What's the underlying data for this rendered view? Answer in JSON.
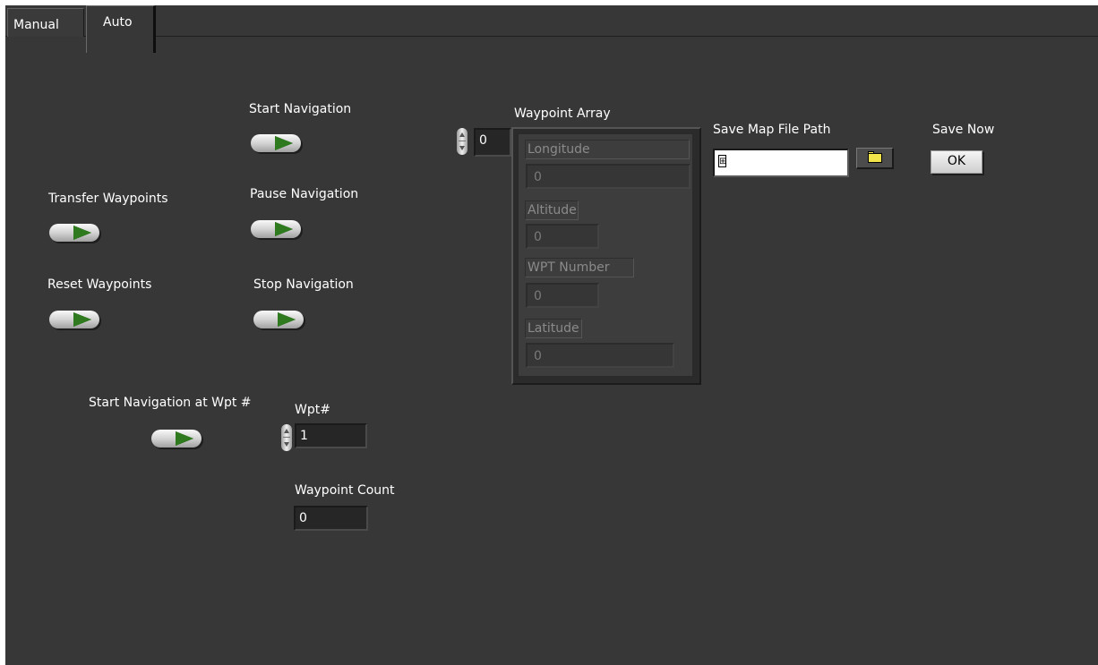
{
  "tabs": {
    "manual": "Manual",
    "auto": "Auto"
  },
  "controls": {
    "start_navigation": "Start Navigation",
    "pause_navigation": "Pause Navigation",
    "stop_navigation": "Stop Navigation",
    "transfer_waypoints": "Transfer Waypoints",
    "reset_waypoints": "Reset Waypoints",
    "start_navigation_at_wpt": "Start Navigation at Wpt #"
  },
  "wpt": {
    "label": "Wpt#",
    "value": "1"
  },
  "waypoint_count": {
    "label": "Waypoint Count",
    "value": "0"
  },
  "waypoint_array": {
    "label": "Waypoint Array",
    "index": "0",
    "fields": {
      "longitude": {
        "label": "Longitude",
        "value": "0"
      },
      "altitude": {
        "label": "Altitude",
        "value": "0"
      },
      "wpt_number": {
        "label": "WPT Number",
        "value": "0"
      },
      "latitude": {
        "label": "Latitude",
        "value": "0"
      }
    }
  },
  "save_map": {
    "label": "Save Map File Path",
    "path": "",
    "browse_icon": "folder-open-icon"
  },
  "save_now": {
    "label": "Save Now",
    "button": "OK"
  },
  "colors": {
    "panel_bg": "#373737",
    "led_green": "#2f7a1e",
    "text": "#ffffff"
  }
}
